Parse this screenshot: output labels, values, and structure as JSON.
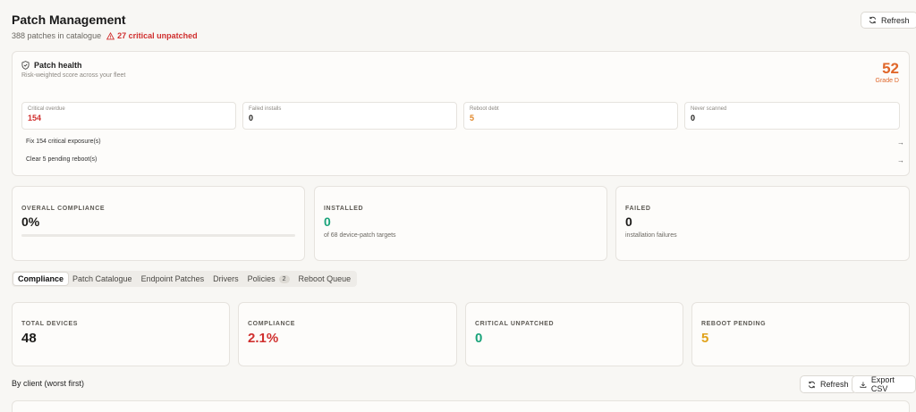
{
  "header": {
    "title": "Patch Management",
    "catalogue_count": "388 patches in catalogue",
    "critical_text": "27 critical unpatched",
    "refresh_label": "Refresh"
  },
  "health": {
    "title": "Patch health",
    "subtitle": "Risk-weighted score across your fleet",
    "score": "52",
    "grade": "Grade D",
    "tiles": [
      {
        "label": "Critical overdue",
        "value": "154",
        "color": "#d0302f"
      },
      {
        "label": "Failed installs",
        "value": "0",
        "color": "#1c1b19"
      },
      {
        "label": "Reboot debt",
        "value": "5",
        "color": "#e0872a"
      },
      {
        "label": "Never scanned",
        "value": "0",
        "color": "#1c1b19"
      }
    ],
    "actions": [
      "Fix 154 critical exposure(s)",
      "Clear 5 pending reboot(s)"
    ]
  },
  "stats": {
    "compliance": {
      "label": "OVERALL COMPLIANCE",
      "value": "0%",
      "progress": 0
    },
    "installed": {
      "label": "INSTALLED",
      "value": "0",
      "note": "of 68 device-patch targets"
    },
    "failed": {
      "label": "FAILED",
      "value": "0",
      "note": "installation failures"
    }
  },
  "tabs": [
    {
      "label": "Compliance",
      "active": true
    },
    {
      "label": "Patch Catalogue"
    },
    {
      "label": "Endpoint Patches"
    },
    {
      "label": "Drivers"
    },
    {
      "label": "Policies",
      "badge": "2"
    },
    {
      "label": "Reboot Queue"
    }
  ],
  "summary": [
    {
      "label": "TOTAL DEVICES",
      "value": "48",
      "color": "#1c1b19"
    },
    {
      "label": "COMPLIANCE",
      "value": "2.1%",
      "color": "#d0302f"
    },
    {
      "label": "CRITICAL UNPATCHED",
      "value": "0",
      "color": "#1aa37a"
    },
    {
      "label": "REBOOT PENDING",
      "value": "5",
      "color": "#e0a21a"
    }
  ],
  "by_client": {
    "title": "By client (worst first)",
    "refresh_label": "Refresh",
    "export_label": "Export CSV"
  },
  "colors": {
    "accent_orange": "#e0672a",
    "critical_red": "#d0302f",
    "success_green": "#1aa37a"
  }
}
